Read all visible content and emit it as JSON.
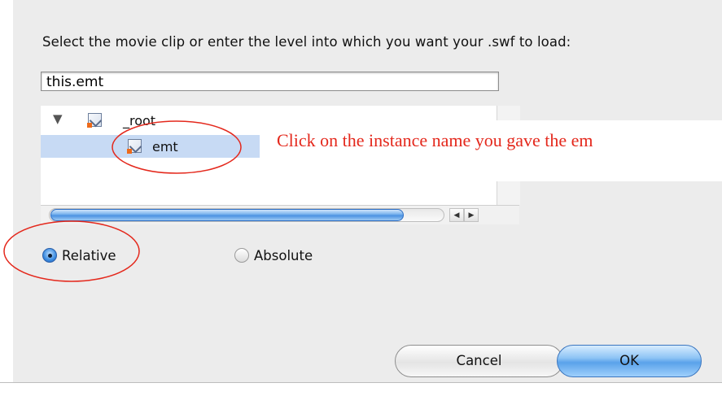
{
  "dialog": {
    "prompt": "Select the movie clip or enter the level into which you want your .swf to load:",
    "target_path": "this.emt"
  },
  "tree": {
    "items": [
      {
        "label": "_root",
        "icon": "movie-clip-icon",
        "expanded": true,
        "level": 0
      },
      {
        "label": "emt",
        "icon": "movie-clip-icon",
        "selected": true,
        "level": 1
      }
    ],
    "disclosure_glyph": "▼"
  },
  "scrollbar": {
    "left_glyph": "◀",
    "right_glyph": "▶"
  },
  "path_mode": {
    "options": [
      {
        "label": "Relative",
        "checked": true
      },
      {
        "label": "Absolute",
        "checked": false
      }
    ]
  },
  "buttons": {
    "cancel": "Cancel",
    "ok": "OK"
  },
  "annotation": {
    "text": "Click on the instance name you gave the em",
    "color": "#e4281c"
  },
  "colors": {
    "selection": "#c7daf4",
    "accent_blue": "#5aa2ea",
    "dialog_bg": "#ececec"
  }
}
